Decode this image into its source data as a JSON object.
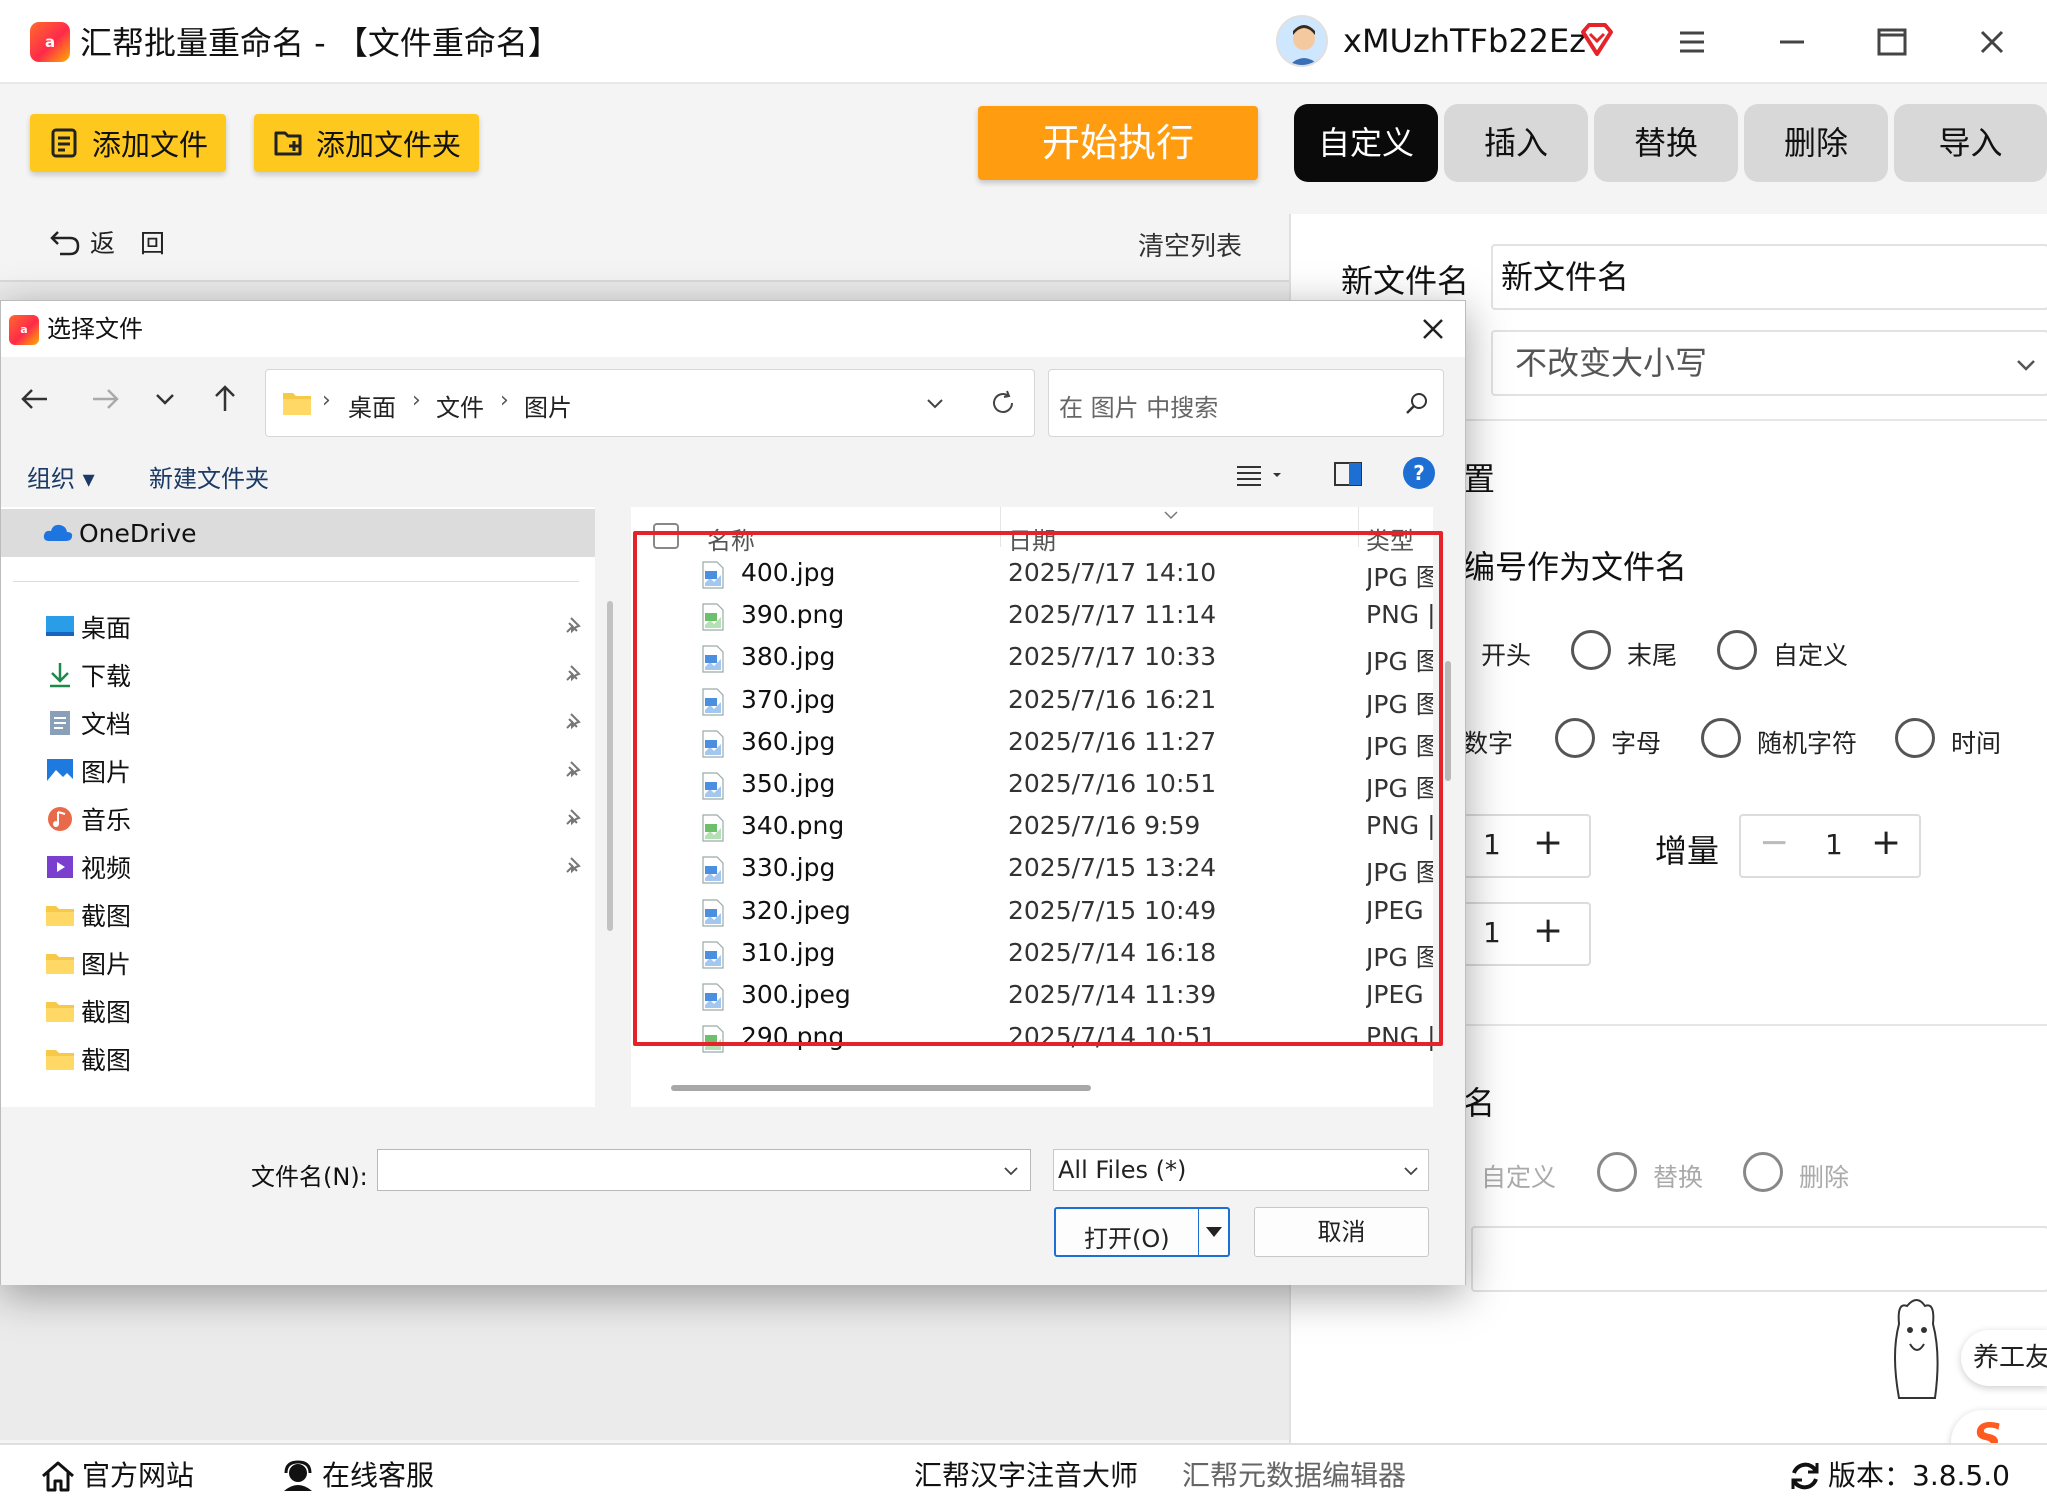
{
  "window": {
    "title": "汇帮批量重命名 - 【文件重命名】",
    "logo_text": "a",
    "username": "xMUzhTFb22Ez"
  },
  "toolbar": {
    "add_files": "添加文件",
    "add_folder": "添加文件夹",
    "start": "开始执行",
    "tabs": [
      {
        "label": "自定义",
        "active": true
      },
      {
        "label": "插入",
        "active": false
      },
      {
        "label": "替换",
        "active": false
      },
      {
        "label": "删除",
        "active": false
      },
      {
        "label": "导入",
        "active": false
      }
    ],
    "back": "返　回",
    "clear_list": "清空列表"
  },
  "right_panel": {
    "new_name_label": "新文件名",
    "new_name_value": "新文件名",
    "case_select": "不改变大小写",
    "section_settings": "置",
    "use_number": "编号作为文件名",
    "position_options": [
      "开头",
      "末尾",
      "自定义"
    ],
    "type_options": [
      "数字",
      "字母",
      "随机字符",
      "时间"
    ],
    "start_value": "1",
    "increment_label": "增量",
    "increment_value": "1",
    "digits_value": "1",
    "section2_partial": "名",
    "mode_options": [
      "自定义",
      "替换",
      "删除"
    ],
    "mascot_text": "养工友"
  },
  "bottombar": {
    "official_site": "官方网站",
    "online_service": "在线客服",
    "pinyin_tool": "汇帮汉字注音大师",
    "metadata_tool": "汇帮元数据编辑器",
    "version": "版本：3.8.5.0"
  },
  "dialog": {
    "title": "选择文件",
    "breadcrumb": [
      "桌面",
      "文件",
      "图片"
    ],
    "search_placeholder": "在 图片 中搜索",
    "organize": "组织 ▾",
    "new_folder": "新建文件夹",
    "nav": {
      "onedrive": "OneDrive",
      "items": [
        {
          "label": "桌面",
          "icon": "desktop-icon",
          "pinned": true
        },
        {
          "label": "下载",
          "icon": "download-icon",
          "pinned": true
        },
        {
          "label": "文档",
          "icon": "document-icon",
          "pinned": true
        },
        {
          "label": "图片",
          "icon": "pictures-icon",
          "pinned": true
        },
        {
          "label": "音乐",
          "icon": "music-icon",
          "pinned": true
        },
        {
          "label": "视频",
          "icon": "video-icon",
          "pinned": true
        },
        {
          "label": "截图",
          "icon": "folder-icon",
          "pinned": false
        },
        {
          "label": "图片",
          "icon": "folder-icon",
          "pinned": false
        },
        {
          "label": "截图",
          "icon": "folder-icon",
          "pinned": false
        },
        {
          "label": "截图",
          "icon": "folder-icon",
          "pinned": false
        }
      ]
    },
    "columns": {
      "name": "名称",
      "date": "日期",
      "type": "类型"
    },
    "files": [
      {
        "name": "400.jpg",
        "date": "2025/7/17 14:10",
        "type": "JPG 图",
        "kind": "jpg"
      },
      {
        "name": "390.png",
        "date": "2025/7/17 11:14",
        "type": "PNG |",
        "kind": "png"
      },
      {
        "name": "380.jpg",
        "date": "2025/7/17 10:33",
        "type": "JPG 图",
        "kind": "jpg"
      },
      {
        "name": "370.jpg",
        "date": "2025/7/16 16:21",
        "type": "JPG 图",
        "kind": "jpg"
      },
      {
        "name": "360.jpg",
        "date": "2025/7/16 11:27",
        "type": "JPG 图",
        "kind": "jpg"
      },
      {
        "name": "350.jpg",
        "date": "2025/7/16 10:51",
        "type": "JPG 图",
        "kind": "jpg"
      },
      {
        "name": "340.png",
        "date": "2025/7/16 9:59",
        "type": "PNG |",
        "kind": "png"
      },
      {
        "name": "330.jpg",
        "date": "2025/7/15 13:24",
        "type": "JPG 图",
        "kind": "jpg"
      },
      {
        "name": "320.jpeg",
        "date": "2025/7/15 10:49",
        "type": "JPEG",
        "kind": "jpeg"
      },
      {
        "name": "310.jpg",
        "date": "2025/7/14 16:18",
        "type": "JPG 图",
        "kind": "jpg"
      },
      {
        "name": "300.jpeg",
        "date": "2025/7/14 11:39",
        "type": "JPEG",
        "kind": "jpeg"
      },
      {
        "name": "290.png",
        "date": "2025/7/14 10:51",
        "type": "PNG |",
        "kind": "png"
      }
    ],
    "filename_label": "文件名(N):",
    "filename_value": "",
    "filetype": "All Files (*)",
    "open_btn": "打开(O)",
    "cancel_btn": "取消"
  },
  "colors": {
    "accent_orange": "#ff9c0f",
    "accent_yellow": "#ffc81e",
    "highlight_red": "#e5232a",
    "active_tab": "#0a0a0a"
  }
}
